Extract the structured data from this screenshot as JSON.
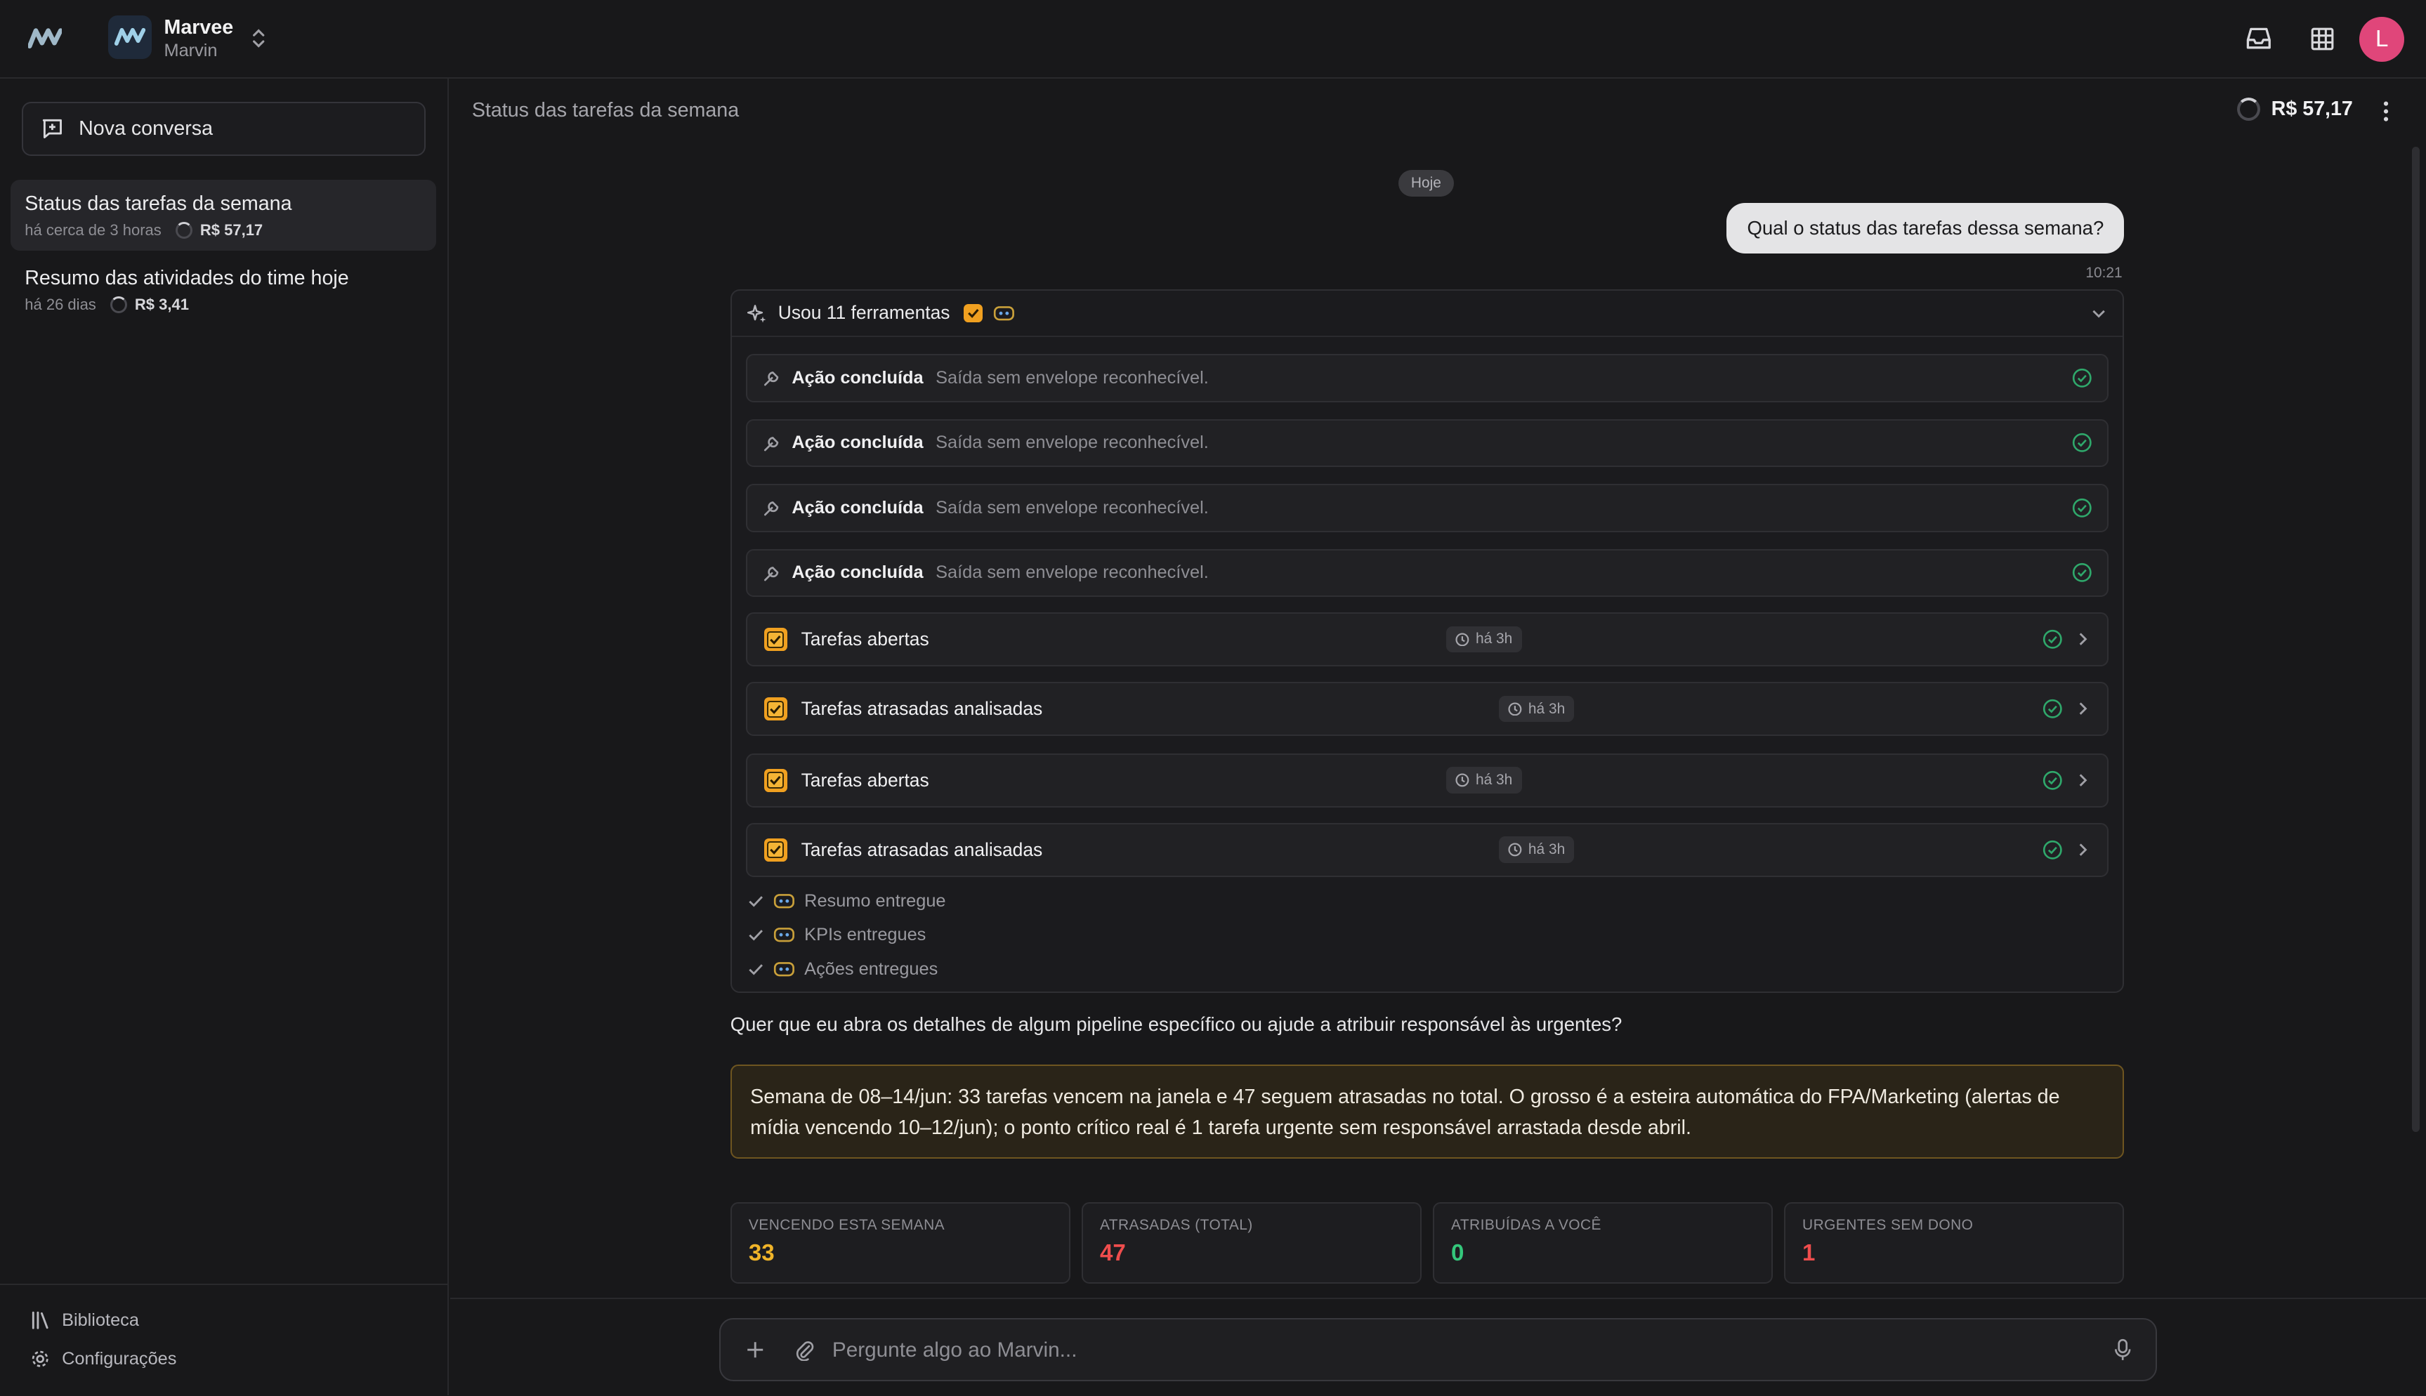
{
  "app": {
    "workspace_name": "Marvee",
    "workspace_sub": "Marvin",
    "avatar_letter": "L",
    "accent": "#e0467a"
  },
  "sidebar": {
    "new_conversation": "Nova conversa",
    "conversations": [
      {
        "title": "Status das tarefas da semana",
        "time": "há cerca de 3 horas",
        "cost": "R$ 57,17",
        "active": true
      },
      {
        "title": "Resumo das atividades do time hoje",
        "time": "há 26 dias",
        "cost": "R$ 3,41",
        "active": false
      }
    ],
    "footer": {
      "library": "Biblioteca",
      "settings": "Configurações"
    }
  },
  "main": {
    "title": "Status das tarefas da semana",
    "cost": "R$ 57,17",
    "day_chip": "Hoje",
    "user_message": "Qual o status das tarefas dessa semana?",
    "user_time": "10:21",
    "tools": {
      "header": "Usou 11 ferramentas",
      "actions": [
        {
          "label": "Ação concluída",
          "desc": "Saída sem envelope reconhecível."
        },
        {
          "label": "Ação concluída",
          "desc": "Saída sem envelope reconhecível."
        },
        {
          "label": "Ação concluída",
          "desc": "Saída sem envelope reconhecível."
        },
        {
          "label": "Ação concluída",
          "desc": "Saída sem envelope reconhecível."
        }
      ],
      "tasks": [
        {
          "label": "Tarefas abertas",
          "time": "há 3h"
        },
        {
          "label": "Tarefas atrasadas analisadas",
          "time": "há 3h"
        },
        {
          "label": "Tarefas abertas",
          "time": "há 3h"
        },
        {
          "label": "Tarefas atrasadas analisadas",
          "time": "há 3h"
        }
      ],
      "delivered": [
        "Resumo entregue",
        "KPIs entregues",
        "Ações entregues"
      ]
    },
    "question": "Quer que eu abra os detalhes de algum pipeline específico ou ajude a atribuir responsável às urgentes?",
    "summary": "Semana de 08–14/jun: 33 tarefas vencem na janela e 47 seguem atrasadas no total. O grosso é a esteira automática do FPA/Marketing (alertas de mídia vencendo 10–12/jun); o ponto crítico real é 1 tarefa urgente sem responsável arrastada desde abril.",
    "kpis": [
      {
        "label": "VENCENDO ESTA SEMANA",
        "value": "33",
        "color": "#f0b429"
      },
      {
        "label": "ATRASADAS (TOTAL)",
        "value": "47",
        "color": "#ef4d4d"
      },
      {
        "label": "ATRIBUÍDAS A VOCÊ",
        "value": "0",
        "color": "#34c77b"
      },
      {
        "label": "URGENTES SEM DONO",
        "value": "1",
        "color": "#ef4d4d"
      }
    ],
    "composer_placeholder": "Pergunte algo ao Marvin..."
  }
}
